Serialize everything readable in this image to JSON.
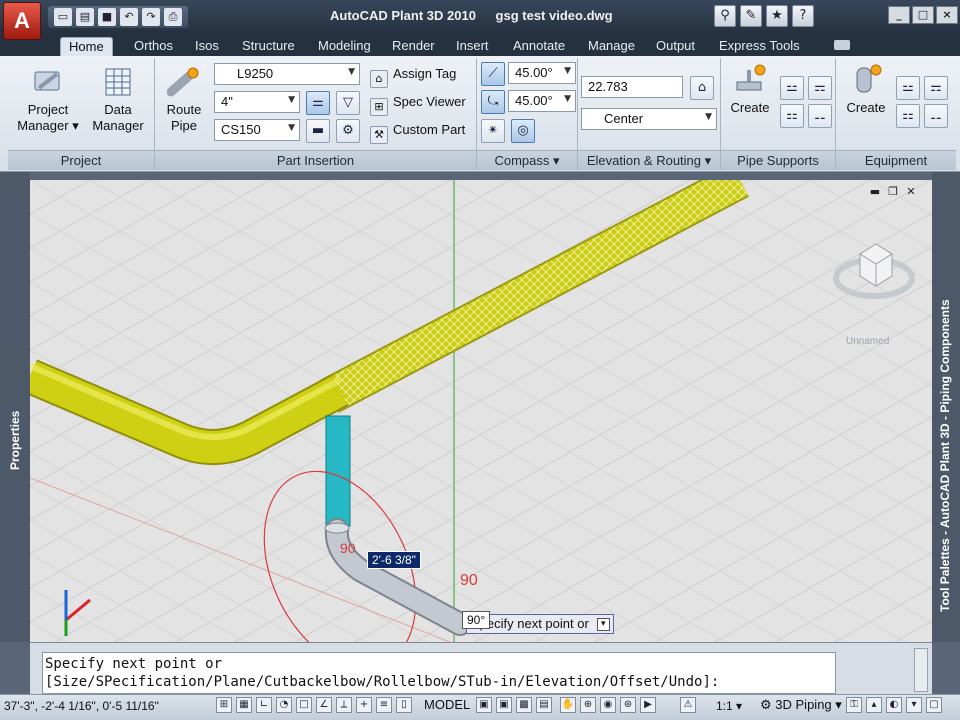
{
  "title": {
    "app": "AutoCAD Plant 3D 2010",
    "file": "gsg test video.dwg"
  },
  "app_button": "A",
  "qat": [
    "new",
    "open",
    "save",
    "undo",
    "redo",
    "plot"
  ],
  "infocenter": [
    "binoculars-icon",
    "wrench-icon",
    "star-icon",
    "help-icon"
  ],
  "window_controls": [
    "_",
    "□",
    "×"
  ],
  "tabs": [
    "Home",
    "Orthos",
    "Isos",
    "Structure",
    "Modeling",
    "Render",
    "Insert",
    "Annotate",
    "Manage",
    "Output",
    "Express Tools"
  ],
  "ribbon": {
    "project": {
      "project_manager_1": "Project",
      "project_manager_2": "Manager",
      "data_manager_1": "Data",
      "data_manager_2": "Manager",
      "title": "Project"
    },
    "part_insertion": {
      "route_pipe_1": "Route",
      "route_pipe_2": "Pipe",
      "spec": "L9250",
      "size": "4\"",
      "material": "CS150",
      "assign_tag": "Assign Tag",
      "spec_viewer": "Spec Viewer",
      "custom_part": "Custom Part",
      "title": "Part Insertion"
    },
    "compass": {
      "angle1": "45.00°",
      "angle2": "45.00°",
      "title": "Compass"
    },
    "elevation": {
      "value": "22.783",
      "justify": "Center",
      "title": "Elevation & Routing"
    },
    "pipe_supports": {
      "create": "Create",
      "title": "Pipe Supports"
    },
    "equipment": {
      "create": "Create",
      "title": "Equipment"
    }
  },
  "left_palette": "Properties",
  "right_palette": "Tool Palettes - AutoCAD Plant 3D - Piping Components",
  "viewport": {
    "view_name": "Unnamed",
    "dimension_input": "2'-6 3/8\"",
    "angle_tip": "90°",
    "prompt_tip": "Specify next point or",
    "angle_label": "90",
    "angle_label2": "90"
  },
  "command_line": {
    "line1": "Specify next point or",
    "line2": "[Size/SPecification/Plane/Cutbackelbow/Rollelbow/STub-in/Elevation/Offset/Undo]:"
  },
  "status": {
    "coords": "37'-3\",   -2'-4 1/16\", 0'-5 11/16\"",
    "model": "MODEL",
    "scale": "1:1",
    "workspace": "3D Piping"
  },
  "colors": {
    "pipe_yellow": "#c8c814",
    "insulation_mesh": "#d6d620",
    "riser_cyan": "#26b8c4",
    "elbow_gray": "#b8bcc6",
    "compass_red": "#d83a3a"
  }
}
